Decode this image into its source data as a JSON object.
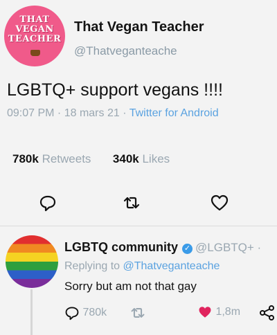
{
  "original_tweet": {
    "avatar_text": [
      "THAT",
      "VEGAN",
      "TEACHER"
    ],
    "display_name": "That Vegan Teacher",
    "handle": "@Thatveganteache",
    "text": "LGBTQ+ support vegans !!!!",
    "time": "09:07 PM",
    "date": "18 mars 21",
    "separator": " · ",
    "client": "Twitter for Android",
    "retweets_count": "780k",
    "retweets_label": "Retweets",
    "likes_count": "340k",
    "likes_label": "Likes",
    "actions": [
      "reply-icon",
      "retweet-icon",
      "heart-icon"
    ]
  },
  "reply": {
    "display_name": "LGBTQ community",
    "verified": true,
    "handle": "@LGBTQ+ ·",
    "replying_prefix": "Replying to ",
    "replying_handle": "@Thatveganteache",
    "text": "Sorry but am not that gay",
    "reply_count": "780k",
    "like_count": "1,8m",
    "colors": {
      "heart": "#e0245e",
      "link": "#5aa2e0",
      "verified": "#3a9be8"
    }
  }
}
